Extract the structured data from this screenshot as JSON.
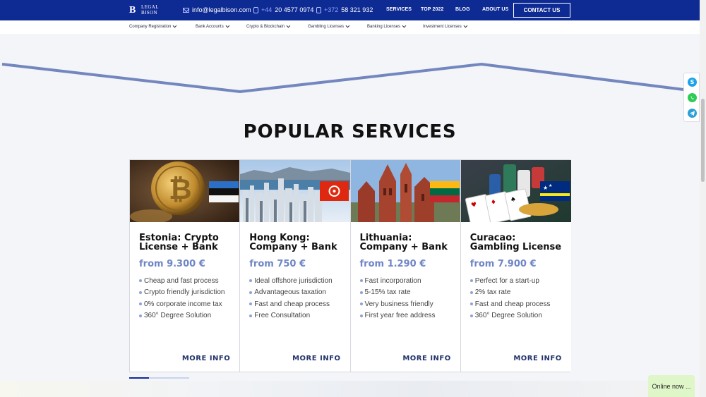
{
  "header": {
    "logo": {
      "mark": "B",
      "line1": "LEGAL",
      "line2": "BISON"
    },
    "email": "info@legalbison.com",
    "phone1": {
      "prefix": "+44",
      "number": "20 4577 0974"
    },
    "phone2": {
      "prefix": "+372",
      "number": "58 321 932"
    },
    "nav": [
      "SERVICES",
      "TOP 2022",
      "BLOG",
      "ABOUT US"
    ],
    "cta": "CONTACT US"
  },
  "subnav": [
    "Company Registration",
    "Bank Accounts",
    "Crypto & Blockchain",
    "Gambling Licenses",
    "Banking Licenses",
    "Investment Licenses"
  ],
  "section": {
    "title": "POPULAR SERVICES"
  },
  "cards": [
    {
      "title": "Estonia: Crypto License + Bank",
      "price": "from 9.300 €",
      "features": [
        "Cheap and fast process",
        "Crypto friendly jurisdiction",
        "0% corporate income tax",
        "360° Degree Solution"
      ],
      "more": "MORE INFO"
    },
    {
      "title": "Hong Kong: Company + Bank",
      "price": "from 750 €",
      "features": [
        "Ideal offshore jurisdiction",
        "Advantageous taxation",
        "Fast and cheap process",
        "Free Consultation"
      ],
      "more": "MORE INFO"
    },
    {
      "title": "Lithuania: Company + Bank",
      "price": "from 1.290 €",
      "features": [
        "Fast incorporation",
        "5-15% tax rate",
        "Very business friendly",
        "First year free address"
      ],
      "more": "MORE INFO"
    },
    {
      "title": "Curacao: Gambling License",
      "price": "from 7.900 €",
      "features": [
        "Perfect for a start-up",
        "2% tax rate",
        "Fast and cheap process",
        "360° Degree Solution"
      ],
      "more": "MORE INFO"
    }
  ],
  "slider": {
    "position": 0.33
  },
  "social": {
    "skype_glyph": "S"
  },
  "chat": {
    "label": "Online now ..."
  },
  "colors": {
    "header": "#0e2a93",
    "price": "#6f86c6",
    "accent_line": "#7386be",
    "chat": "#dff7c8"
  }
}
